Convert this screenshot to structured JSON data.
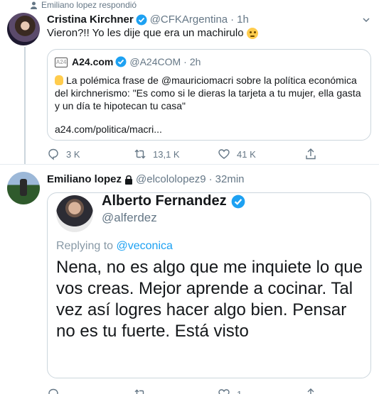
{
  "context": {
    "text": "Emiliano lopez respondió"
  },
  "tweet1": {
    "name": "Cristina Kirchner",
    "handle": "@CFKArgentina",
    "separator": "·",
    "time": "1h",
    "text": "Vieron?!! Yo les dije que era un machirulo",
    "emoji": "rolling-eyes-emoji"
  },
  "quote": {
    "logo": "A24",
    "name": "A24.com",
    "handle": "@A24COM",
    "separator": "·",
    "time": "2h",
    "text": "La polémica frase de @mauriciomacri sobre la política económica del kirchnerismo: \"Es como si le dieras la tarjeta a tu mujer, ella gasta y un día te hipotecan tu casa\"",
    "link": "a24.com/politica/macri..."
  },
  "actions1": {
    "replies": "3 K",
    "retweets": "13,1 K",
    "likes": "41 K"
  },
  "tweet2": {
    "name": "Emiliano lopez",
    "handle": "@elcololopez9",
    "separator": "·",
    "time": "32min"
  },
  "image_tweet": {
    "name": "Alberto Fernandez",
    "handle": "@alferdez",
    "replying_prefix": "Replying to",
    "replying_handle": "@veconica",
    "text": "Nena, no es algo que me inquiete lo que vos creas. Mejor aprende a cocinar. Tal vez así logres hacer algo bien. Pensar no es tu fuerte. Está visto"
  },
  "actions2": {
    "replies": "",
    "retweets": "",
    "likes": "1"
  },
  "colors": {
    "accent": "#1da1f2",
    "muted": "#657786",
    "border": "#ccd6dd"
  }
}
